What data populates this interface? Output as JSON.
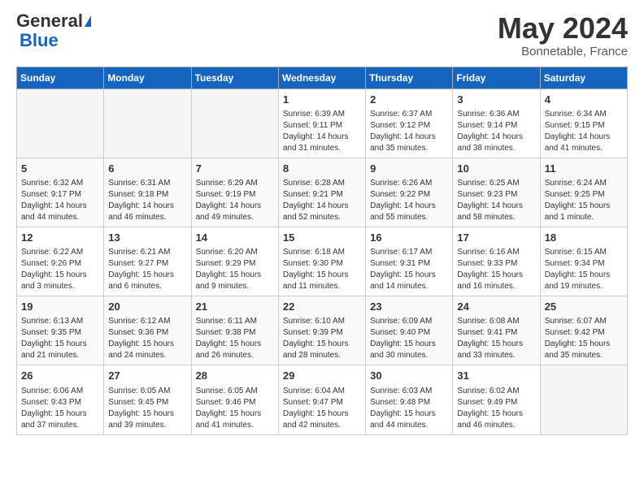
{
  "header": {
    "logo_general": "General",
    "logo_blue": "Blue",
    "month_year": "May 2024",
    "location": "Bonnetable, France"
  },
  "weekdays": [
    "Sunday",
    "Monday",
    "Tuesday",
    "Wednesday",
    "Thursday",
    "Friday",
    "Saturday"
  ],
  "weeks": [
    [
      {
        "day": "",
        "info": ""
      },
      {
        "day": "",
        "info": ""
      },
      {
        "day": "",
        "info": ""
      },
      {
        "day": "1",
        "info": "Sunrise: 6:39 AM\nSunset: 9:11 PM\nDaylight: 14 hours and 31 minutes."
      },
      {
        "day": "2",
        "info": "Sunrise: 6:37 AM\nSunset: 9:12 PM\nDaylight: 14 hours and 35 minutes."
      },
      {
        "day": "3",
        "info": "Sunrise: 6:36 AM\nSunset: 9:14 PM\nDaylight: 14 hours and 38 minutes."
      },
      {
        "day": "4",
        "info": "Sunrise: 6:34 AM\nSunset: 9:15 PM\nDaylight: 14 hours and 41 minutes."
      }
    ],
    [
      {
        "day": "5",
        "info": "Sunrise: 6:32 AM\nSunset: 9:17 PM\nDaylight: 14 hours and 44 minutes."
      },
      {
        "day": "6",
        "info": "Sunrise: 6:31 AM\nSunset: 9:18 PM\nDaylight: 14 hours and 46 minutes."
      },
      {
        "day": "7",
        "info": "Sunrise: 6:29 AM\nSunset: 9:19 PM\nDaylight: 14 hours and 49 minutes."
      },
      {
        "day": "8",
        "info": "Sunrise: 6:28 AM\nSunset: 9:21 PM\nDaylight: 14 hours and 52 minutes."
      },
      {
        "day": "9",
        "info": "Sunrise: 6:26 AM\nSunset: 9:22 PM\nDaylight: 14 hours and 55 minutes."
      },
      {
        "day": "10",
        "info": "Sunrise: 6:25 AM\nSunset: 9:23 PM\nDaylight: 14 hours and 58 minutes."
      },
      {
        "day": "11",
        "info": "Sunrise: 6:24 AM\nSunset: 9:25 PM\nDaylight: 15 hours and 1 minute."
      }
    ],
    [
      {
        "day": "12",
        "info": "Sunrise: 6:22 AM\nSunset: 9:26 PM\nDaylight: 15 hours and 3 minutes."
      },
      {
        "day": "13",
        "info": "Sunrise: 6:21 AM\nSunset: 9:27 PM\nDaylight: 15 hours and 6 minutes."
      },
      {
        "day": "14",
        "info": "Sunrise: 6:20 AM\nSunset: 9:29 PM\nDaylight: 15 hours and 9 minutes."
      },
      {
        "day": "15",
        "info": "Sunrise: 6:18 AM\nSunset: 9:30 PM\nDaylight: 15 hours and 11 minutes."
      },
      {
        "day": "16",
        "info": "Sunrise: 6:17 AM\nSunset: 9:31 PM\nDaylight: 15 hours and 14 minutes."
      },
      {
        "day": "17",
        "info": "Sunrise: 6:16 AM\nSunset: 9:33 PM\nDaylight: 15 hours and 16 minutes."
      },
      {
        "day": "18",
        "info": "Sunrise: 6:15 AM\nSunset: 9:34 PM\nDaylight: 15 hours and 19 minutes."
      }
    ],
    [
      {
        "day": "19",
        "info": "Sunrise: 6:13 AM\nSunset: 9:35 PM\nDaylight: 15 hours and 21 minutes."
      },
      {
        "day": "20",
        "info": "Sunrise: 6:12 AM\nSunset: 9:36 PM\nDaylight: 15 hours and 24 minutes."
      },
      {
        "day": "21",
        "info": "Sunrise: 6:11 AM\nSunset: 9:38 PM\nDaylight: 15 hours and 26 minutes."
      },
      {
        "day": "22",
        "info": "Sunrise: 6:10 AM\nSunset: 9:39 PM\nDaylight: 15 hours and 28 minutes."
      },
      {
        "day": "23",
        "info": "Sunrise: 6:09 AM\nSunset: 9:40 PM\nDaylight: 15 hours and 30 minutes."
      },
      {
        "day": "24",
        "info": "Sunrise: 6:08 AM\nSunset: 9:41 PM\nDaylight: 15 hours and 33 minutes."
      },
      {
        "day": "25",
        "info": "Sunrise: 6:07 AM\nSunset: 9:42 PM\nDaylight: 15 hours and 35 minutes."
      }
    ],
    [
      {
        "day": "26",
        "info": "Sunrise: 6:06 AM\nSunset: 9:43 PM\nDaylight: 15 hours and 37 minutes."
      },
      {
        "day": "27",
        "info": "Sunrise: 6:05 AM\nSunset: 9:45 PM\nDaylight: 15 hours and 39 minutes."
      },
      {
        "day": "28",
        "info": "Sunrise: 6:05 AM\nSunset: 9:46 PM\nDaylight: 15 hours and 41 minutes."
      },
      {
        "day": "29",
        "info": "Sunrise: 6:04 AM\nSunset: 9:47 PM\nDaylight: 15 hours and 42 minutes."
      },
      {
        "day": "30",
        "info": "Sunrise: 6:03 AM\nSunset: 9:48 PM\nDaylight: 15 hours and 44 minutes."
      },
      {
        "day": "31",
        "info": "Sunrise: 6:02 AM\nSunset: 9:49 PM\nDaylight: 15 hours and 46 minutes."
      },
      {
        "day": "",
        "info": ""
      }
    ]
  ]
}
